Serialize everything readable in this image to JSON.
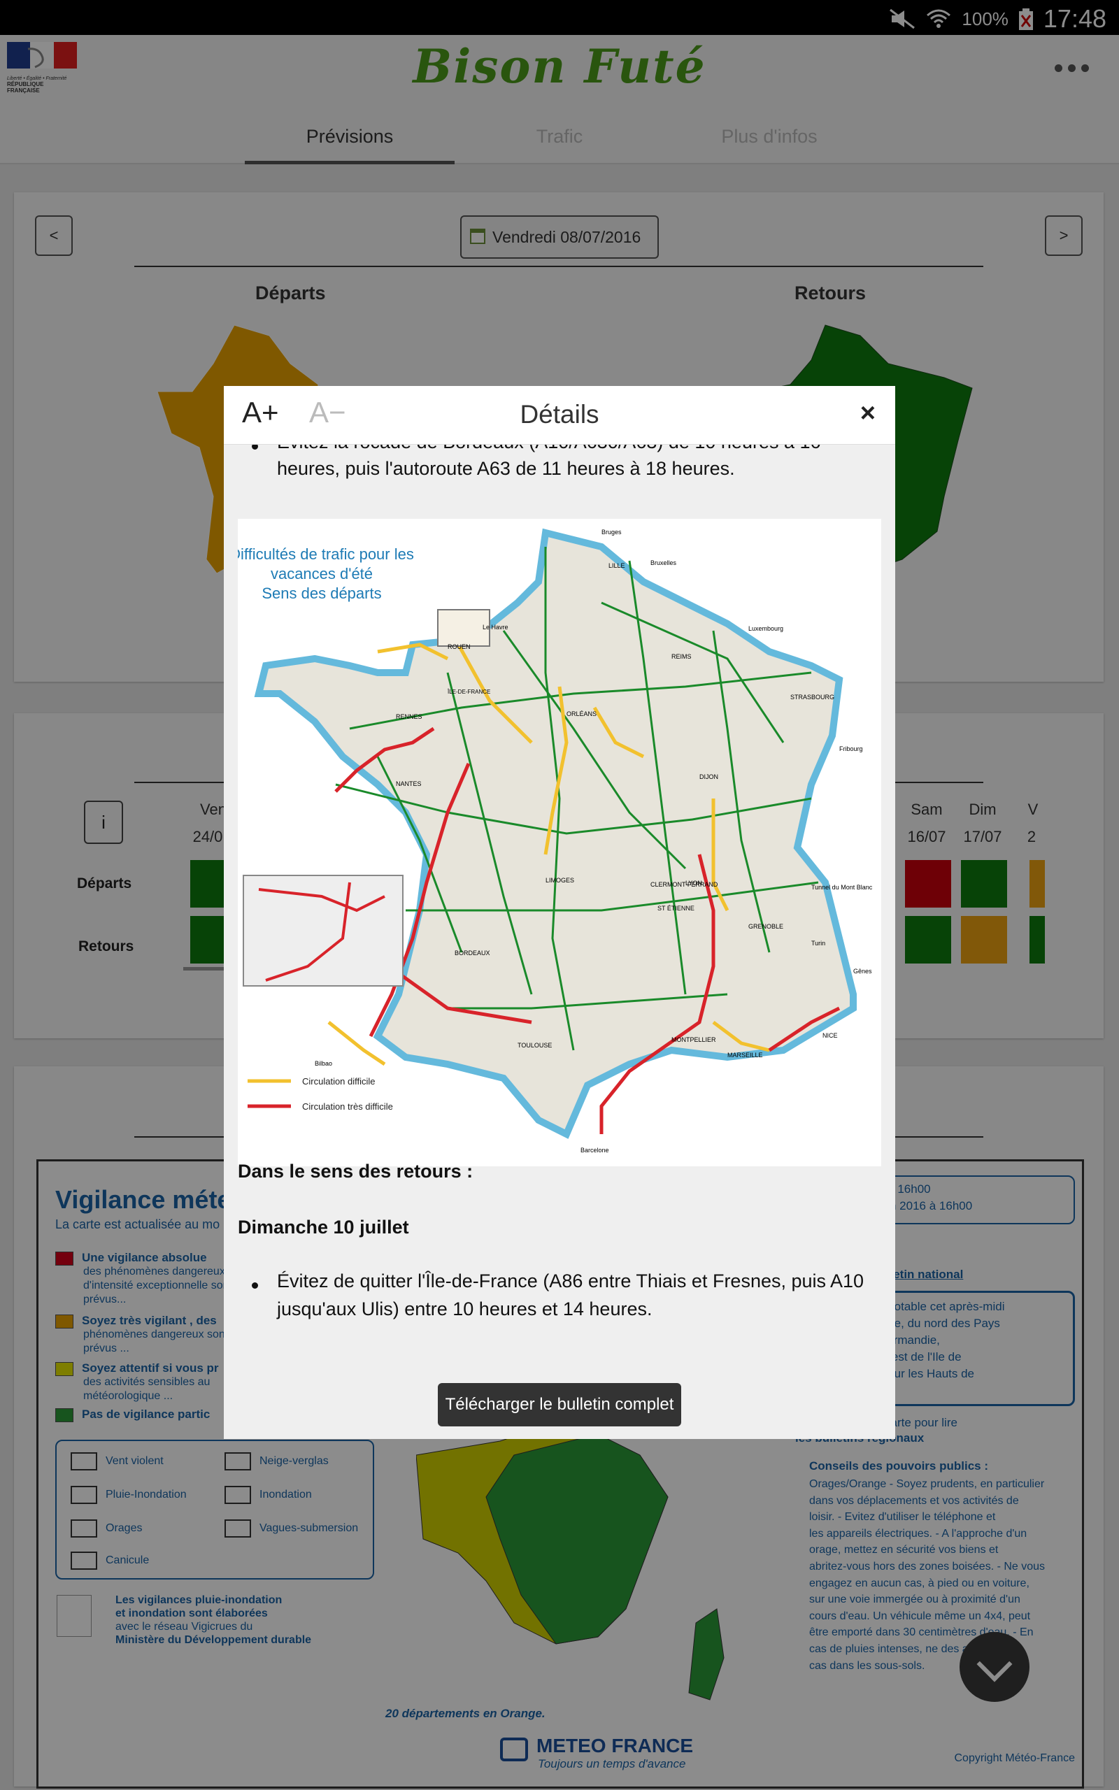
{
  "status_bar": {
    "battery": "100%",
    "time": "17:48"
  },
  "app": {
    "brand": "Bison Futé",
    "gov_logo_text": "RÉPUBLIQUE FRANÇAISE",
    "gov_motto": "Liberté • Égalité • Fraternité",
    "tabs": [
      {
        "label": "Prévisions",
        "active": true
      },
      {
        "label": "Trafic",
        "active": false
      },
      {
        "label": "Plus d'infos",
        "active": false
      }
    ]
  },
  "forecast": {
    "prev_label": "<",
    "next_label": ">",
    "date_label": "Vendredi 08/07/2016",
    "departures_title": "Départs",
    "returns_title": "Retours",
    "info_label": "i",
    "row_departures": "Départs",
    "row_returns": "Retours",
    "days": [
      {
        "name": "Ven",
        "date": "24/0"
      },
      {
        "name": "Sam",
        "date": "16/07"
      },
      {
        "name": "Dim",
        "date": "17/07"
      },
      {
        "name": "V",
        "date": "2"
      }
    ],
    "colors": {
      "green": "#0e7a0e",
      "red": "#c8000b",
      "orange": "#eba011",
      "map_departures": "#e8a000",
      "map_returns": "#0e7a0e"
    }
  },
  "vigilance": {
    "title": "Vigilance méte",
    "subtitle": "La carte est actualisée au mo",
    "legend": [
      {
        "label": "Une vigilance absolue",
        "color": "#d4001a",
        "desc": "des phénomènes dangereux d'intensité exceptionnelle sont prévus..."
      },
      {
        "label": "Soyez très vigilant , des",
        "color": "#e8a000",
        "desc": "phénomènes dangereux sont prévus ..."
      },
      {
        "label": "Soyez attentif si vous pr",
        "color": "#e6e600",
        "desc": "des activités sensibles au météorologique ..."
      },
      {
        "label": "Pas de vigilance partic",
        "color": "#2a9a38",
        "desc": ""
      }
    ],
    "pictos": [
      {
        "label": "Vent violent"
      },
      {
        "label": "Neige-verglas"
      },
      {
        "label": "Pluie-Inondation"
      },
      {
        "label": "Inondation"
      },
      {
        "label": "Orages"
      },
      {
        "label": "Vagues-submersion"
      },
      {
        "label": "Canicule"
      }
    ],
    "ministry_note": [
      "Les vigilances pluie-inondation",
      "et inondation sont élaborées",
      "avec le réseau Vigicrues du",
      "Ministère du Développement durable"
    ],
    "valid_lines": [
      "6 à 16h00",
      "juin 2016 à 16h00"
    ],
    "bulletin_title": "bulletin national",
    "bulletin_lines": [
      "x notable cet après-midi",
      "aine, du nord des Pays",
      "Normandie,",
      "ouest de l'Ile de",
      "e sur les Hauts de"
    ],
    "regional_lines": [
      "carte pour lire",
      "les bulletins régionaux"
    ],
    "advice_title": "Conseils des pouvoirs publics :",
    "advice_lines": [
      "Orages/Orange - Soyez prudents, en particulier",
      "dans vos déplacements et vos activités de",
      "loisir. - Evitez d'utiliser le téléphone et",
      "les appareils électriques. - A l'approche d'un",
      "orage, mettez en sécurité vos biens et",
      "abritez-vous hors des zones boisées. - Ne vous",
      "engagez en aucun cas, à pied ou en voiture,",
      "sur une voie immergée ou à proximité d'un",
      "cours d'eau. Un véhicule même un 4x4, peut",
      "être emporté dans 30 centimètres d'eau. - En",
      "cas de pluies intenses, ne des          aucun",
      "cas dans les sous-sols."
    ],
    "orange_count": "20 départements en Orange.",
    "meteo_brand": "METEO FRANCE",
    "meteo_tagline": "Toujours un temps d'avance",
    "copyright": "Copyright Météo-France"
  },
  "modal": {
    "font_increase": "A+",
    "font_decrease": "A−",
    "title": "Détails",
    "close": "×",
    "partial_line": "Évitez la rocade de Bordeaux (A10/A630/A63) de 10 heures à 16",
    "line_cont": "heures, puis l'autoroute A63 de 11 heures à 18 heures.",
    "map_title": [
      "Difficultés de trafic pour les",
      "vacances d'été",
      "Sens des départs"
    ],
    "map_legend": [
      {
        "label": "Circulation difficile",
        "color": "#f2c12e"
      },
      {
        "label": "Circulation très difficile",
        "color": "#d8232a"
      }
    ],
    "map_cities": [
      "Bruges",
      "LILLE",
      "Bruxelles",
      "Luxembourg",
      "ROUEN",
      "Le Havre",
      "REIMS",
      "STRASBOURG",
      "ÎLE-DE-FRANCE",
      "RENNES",
      "ORLÉANS",
      "Fribourg",
      "NANTES",
      "DIJON",
      "LIMOGES",
      "CLERMONT FERRAND",
      "LYON",
      "Tunnel du Mont Blanc",
      "ST ÉTIENNE",
      "GRENOBLE",
      "Turin",
      "BORDEAUX",
      "Gênes",
      "NICE",
      "MONTPELLIER",
      "TOULOUSE",
      "MARSEILLE",
      "Bilbao",
      "Barcelone"
    ],
    "returns_heading": "Dans le sens des retours :",
    "date_heading": "Dimanche 10 juillet",
    "return_bullet_1": "Évitez de quitter l'Île-de-France (A86 entre Thiais et Fresnes, puis A10",
    "return_bullet_2": "jusqu'aux Ulis) entre 10 heures et 14 heures.",
    "download_label": "Télécharger le bulletin complet"
  }
}
